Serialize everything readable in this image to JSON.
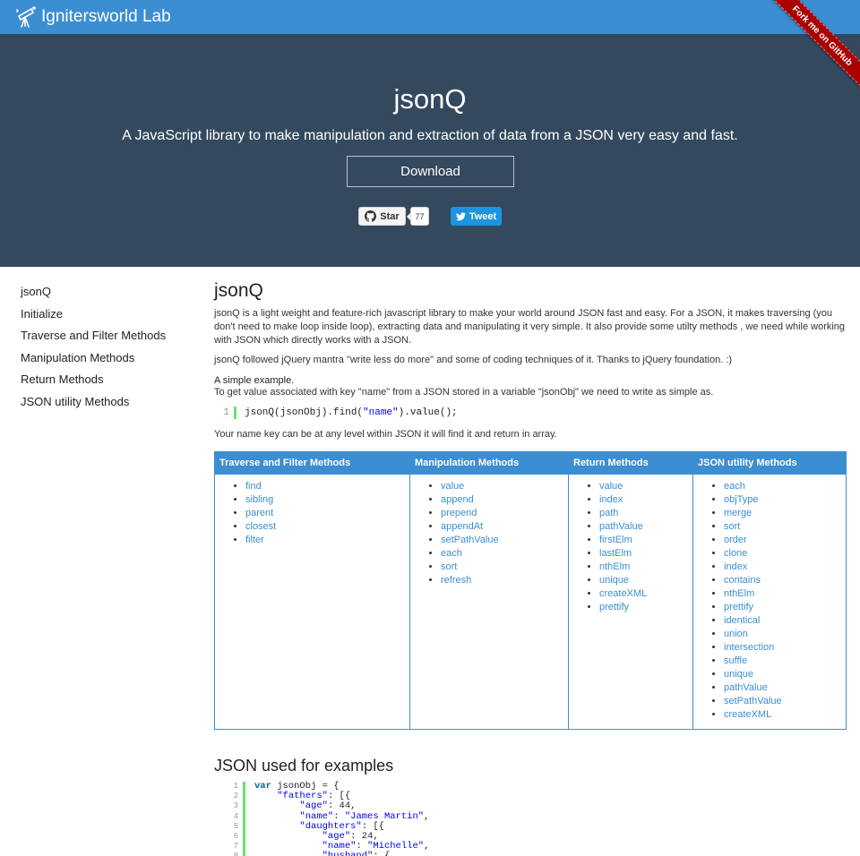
{
  "navbar": {
    "brand": "Ignitersworld Lab",
    "brand_icon": "telescope-icon"
  },
  "ribbon": {
    "label": "Fork me on GitHub",
    "color": "#aa0000"
  },
  "hero": {
    "title": "jsonQ",
    "subtitle": "A JavaScript library to make manipulation and extraction of data from a JSON very easy and fast.",
    "download_label": "Download",
    "star_label": "Star",
    "star_count": "77",
    "tweet_label": "Tweet"
  },
  "sidebar": {
    "items": [
      {
        "label": "jsonQ"
      },
      {
        "label": "Initialize"
      },
      {
        "label": "Traverse and Filter Methods"
      },
      {
        "label": "Manipulation Methods"
      },
      {
        "label": "Return Methods"
      },
      {
        "label": "JSON utility Methods"
      }
    ]
  },
  "main": {
    "title": "jsonQ",
    "para1": "jsonQ is a light weight and feature-rich javascript library to make your world around JSON fast and easy. For a JSON, it makes traversing (you don't need to make loop inside loop), extracting data and manipulating it very simple.  It also provide some utilty methods , we need while working with JSON which directly works with a JSON.",
    "para2": "jsonQ followed jQuery mantra \"write less do more\" and some of coding techniques of it. Thanks to jQuery foundation. :)",
    "example_title": "A simple example.",
    "example_desc": "To get value associated with key \"name\" from a JSON stored in a variable \"jsonObj\" we need to write as simple as.",
    "code": {
      "line_no": "1",
      "prefix": "jsonQ(jsonObj).find(",
      "string": "\"name\"",
      "suffix": ").value();"
    },
    "para3": "Your name key can be at any level within JSON it will find it and return in array."
  },
  "methods": {
    "columns": [
      {
        "header": "Traverse and Filter Methods",
        "items": [
          "find",
          "sibling",
          "parent",
          "closest",
          "filter"
        ]
      },
      {
        "header": "Manipulation Methods",
        "items": [
          "value",
          "append",
          "prepend",
          "appendAt",
          "setPathValue",
          "each",
          "sort",
          "refresh"
        ]
      },
      {
        "header": "Return Methods",
        "items": [
          "value",
          "index",
          "path",
          "pathValue",
          "firstElm",
          "lastElm",
          "nthElm",
          "unique",
          "createXML",
          "prettify"
        ]
      },
      {
        "header": "JSON utility Methods",
        "items": [
          "each",
          "objType",
          "merge",
          "sort",
          "order",
          "clone",
          "index",
          "contains",
          "nthElm",
          "prettify",
          "identical",
          "union",
          "intersection",
          "suffle",
          "unique",
          "pathValue",
          "setPathValue",
          "createXML"
        ]
      }
    ]
  },
  "json_section": {
    "title": "JSON used for examples",
    "lines": [
      {
        "n": "1",
        "indent": "",
        "parts": [
          [
            "kw",
            "var"
          ],
          [
            "t",
            " jsonObj = {"
          ]
        ]
      },
      {
        "n": "2",
        "indent": "    ",
        "parts": [
          [
            "s",
            "\"fathers\""
          ],
          [
            "t",
            ": [{"
          ]
        ]
      },
      {
        "n": "3",
        "indent": "        ",
        "parts": [
          [
            "s",
            "\"age\""
          ],
          [
            "t",
            ": 44,"
          ]
        ]
      },
      {
        "n": "4",
        "indent": "        ",
        "parts": [
          [
            "s",
            "\"name\""
          ],
          [
            "t",
            ": "
          ],
          [
            "s",
            "\"James Martin\""
          ],
          [
            "t",
            ","
          ]
        ]
      },
      {
        "n": "5",
        "indent": "        ",
        "parts": [
          [
            "s",
            "\"daughters\""
          ],
          [
            "t",
            ": [{"
          ]
        ]
      },
      {
        "n": "6",
        "indent": "            ",
        "parts": [
          [
            "s",
            "\"age\""
          ],
          [
            "t",
            ": 24,"
          ]
        ]
      },
      {
        "n": "7",
        "indent": "            ",
        "parts": [
          [
            "s",
            "\"name\""
          ],
          [
            "t",
            ": "
          ],
          [
            "s",
            "\"Michelle\""
          ],
          [
            "t",
            ","
          ]
        ]
      },
      {
        "n": "8",
        "indent": "            ",
        "parts": [
          [
            "s",
            "\"husband\""
          ],
          [
            "t",
            ": {"
          ]
        ]
      }
    ]
  },
  "colors": {
    "navbar": "#3b8ed2",
    "hero": "#34495e",
    "link": "#3b8ed2",
    "code_bar": "#6ce26c"
  }
}
